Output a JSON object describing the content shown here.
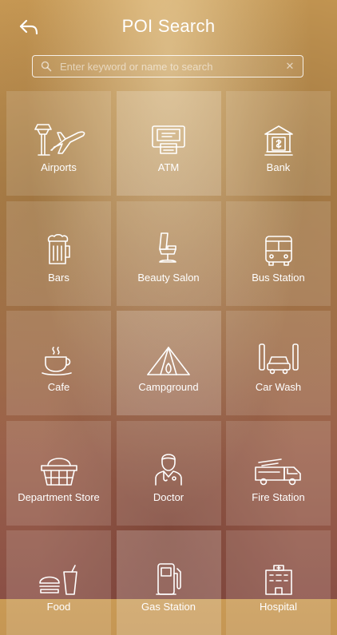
{
  "header": {
    "title": "POI Search"
  },
  "search": {
    "placeholder": "Enter keyword or name to search"
  },
  "categories": [
    {
      "label": "Airports",
      "icon": "airport-icon"
    },
    {
      "label": "ATM",
      "icon": "atm-icon"
    },
    {
      "label": "Bank",
      "icon": "bank-icon"
    },
    {
      "label": "Bars",
      "icon": "beer-mug-icon"
    },
    {
      "label": "Beauty Salon",
      "icon": "salon-chair-icon"
    },
    {
      "label": "Bus Station",
      "icon": "bus-icon"
    },
    {
      "label": "Cafe",
      "icon": "coffee-cup-icon"
    },
    {
      "label": "Campground",
      "icon": "tent-icon"
    },
    {
      "label": "Car Wash",
      "icon": "car-wash-icon"
    },
    {
      "label": "Department Store",
      "icon": "shopping-basket-icon"
    },
    {
      "label": "Doctor",
      "icon": "doctor-icon"
    },
    {
      "label": "Fire Station",
      "icon": "fire-truck-icon"
    },
    {
      "label": "Food",
      "icon": "fast-food-icon"
    },
    {
      "label": "Gas Station",
      "icon": "gas-pump-icon"
    },
    {
      "label": "Hospital",
      "icon": "hospital-icon"
    }
  ]
}
